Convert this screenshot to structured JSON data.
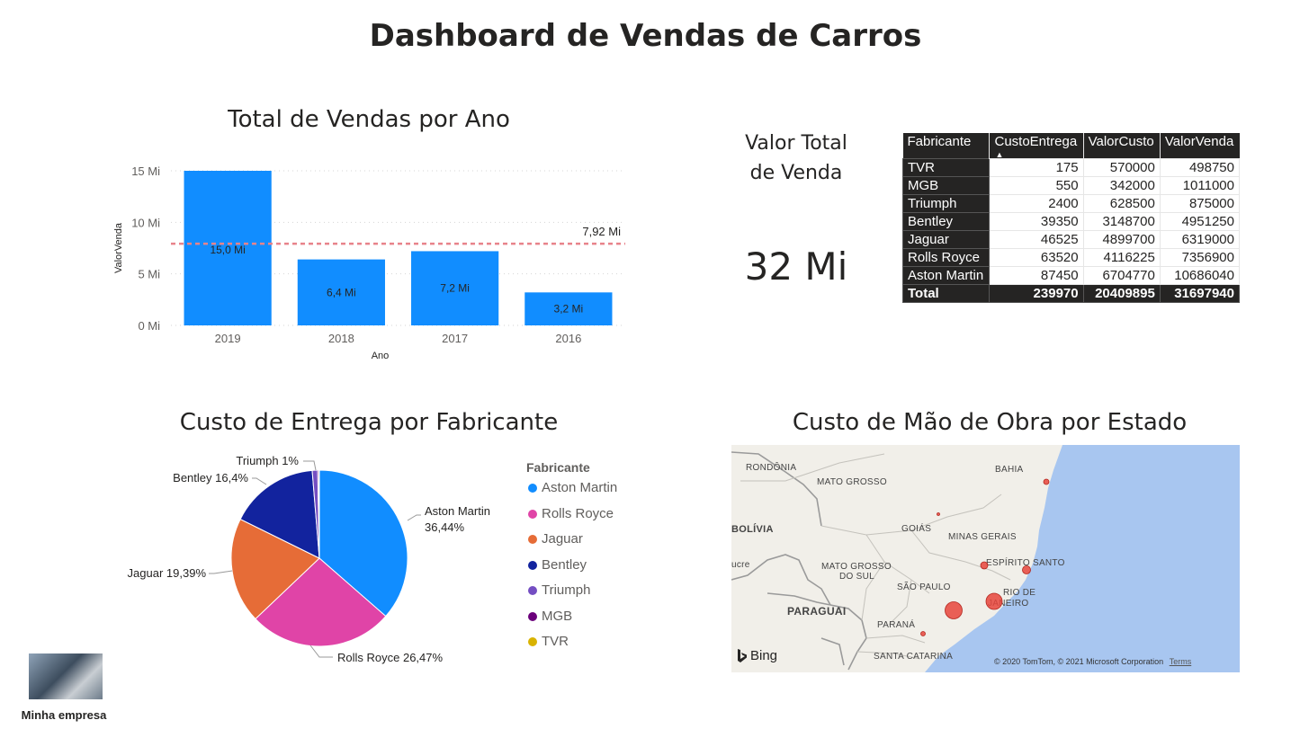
{
  "dashboard": {
    "title": "Dashboard de Vendas de Carros"
  },
  "colors": {
    "bar": "#118dff",
    "average_line": "#e8838b",
    "Aston Martin": "#118dff",
    "Rolls Royce": "#e044a7",
    "Jaguar": "#e66c37",
    "Bentley": "#12239e",
    "Triumph": "#744ec2",
    "MGB": "#6b007b",
    "TVR": "#d9b300",
    "ocean": "#a8c6f0",
    "land": "#f1efe9",
    "bubble": "#e8453c"
  },
  "bar_visual": {
    "title": "Total de Vendas por Ano"
  },
  "pie_visual": {
    "title": "Custo de Entrega por Fabricante"
  },
  "map_visual": {
    "title": "Custo de Mão de Obra por Estado",
    "labels": {
      "rondonia": "RONDÔNIA",
      "mato_grosso": "MATO GROSSO",
      "bahia": "BAHIA",
      "bolivia": "BOLÍVIA",
      "goias": "GOIÁS",
      "minas_gerais": "MINAS GERAIS",
      "acre": "ucre",
      "mato_grosso_do_sul": "MATO GROSSO",
      "mato_grosso_do_sul_2": "DO SUL",
      "espirito_santo": "ESPÍRITO SANTO",
      "sao_paulo": "SÃO PAULO",
      "rio_1": "RIO DE",
      "rio_2": "JANEIRO",
      "paraguai": "PARAGUAI",
      "parana": "PARANÁ",
      "santa_catarina": "SANTA CATARINA"
    },
    "bing": "Bing",
    "attribution": "© 2020 TomTom, © 2021 Microsoft Corporation",
    "terms": "Terms"
  },
  "kpi": {
    "label_line1": "Valor Total",
    "label_line2": "de Venda",
    "value": "32 Mi"
  },
  "table": {
    "headers": [
      "Fabricante",
      "CustoEntrega",
      "ValorCusto",
      "ValorVenda"
    ],
    "rows": [
      [
        "TVR",
        "175",
        "570000",
        "498750"
      ],
      [
        "MGB",
        "550",
        "342000",
        "1011000"
      ],
      [
        "Triumph",
        "2400",
        "628500",
        "875000"
      ],
      [
        "Bentley",
        "39350",
        "3148700",
        "4951250"
      ],
      [
        "Jaguar",
        "46525",
        "4899700",
        "6319000"
      ],
      [
        "Rolls Royce",
        "63520",
        "4116225",
        "7356900"
      ],
      [
        "Aston Martin",
        "87450",
        "6704770",
        "10686040"
      ]
    ],
    "total": [
      "Total",
      "239970",
      "20409895",
      "31697940"
    ]
  },
  "legend": {
    "title": "Fabricante",
    "items": [
      "Aston Martin",
      "Rolls Royce",
      "Jaguar",
      "Bentley",
      "Triumph",
      "MGB",
      "TVR"
    ]
  },
  "company": {
    "name": "Minha empresa"
  },
  "chart_data": [
    {
      "type": "bar",
      "title": "Total de Vendas por Ano",
      "xlabel": "Ano",
      "ylabel": "ValorVenda",
      "categories": [
        "2019",
        "2018",
        "2017",
        "2016"
      ],
      "values": [
        15.0,
        6.4,
        7.2,
        3.2
      ],
      "data_labels": [
        "15,0 Mi",
        "6,4 Mi",
        "7,2 Mi",
        "3,2 Mi"
      ],
      "yticks": [
        0,
        5,
        10,
        15
      ],
      "ytick_labels": [
        "0 Mi",
        "5 Mi",
        "10 Mi",
        "15 Mi"
      ],
      "ylim": [
        0,
        15
      ],
      "average_line": {
        "value": 7.92,
        "label": "7,92 Mi"
      },
      "grid": true
    },
    {
      "type": "pie",
      "title": "Custo de Entrega por Fabricante",
      "categories": [
        "Aston Martin",
        "Rolls Royce",
        "Jaguar",
        "Bentley",
        "Triumph",
        "MGB",
        "TVR"
      ],
      "values": [
        87450,
        63520,
        46525,
        39350,
        2400,
        550,
        175
      ],
      "slice_labels": [
        "Aston Martin",
        "36,44%",
        "Rolls Royce 26,47%",
        "Jaguar 19,39%",
        "Bentley 16,4%",
        "Triumph 1%"
      ],
      "legend": "right"
    }
  ]
}
